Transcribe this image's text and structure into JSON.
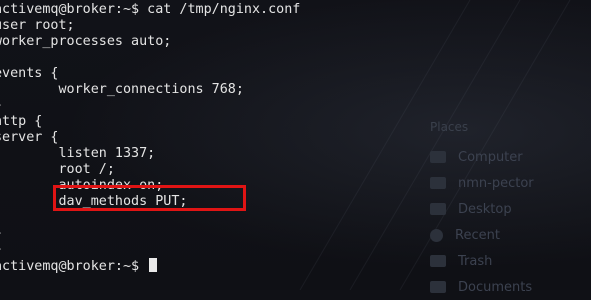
{
  "terminal": {
    "lines": [
      "activemq@broker:~$ cat /tmp/nginx.conf",
      "user root;",
      "worker_processes auto;",
      "",
      "events {",
      "        worker_connections 768;",
      "}",
      "http {",
      "server {",
      "        listen 1337;",
      "        root /;",
      "        autoindex on;",
      "        dav_methods PUT;",
      "",
      "}",
      "}",
      "activemq@broker:~$ "
    ],
    "highlighted_line_index": 12
  },
  "background": {
    "places_header": "Places",
    "places_items": [
      "Computer",
      "nmn-pector",
      "Desktop",
      "Recent",
      "Trash",
      "Documents"
    ]
  },
  "colors": {
    "terminal_bg": "#101116",
    "text": "#e4e4e4",
    "highlight_border": "#e01414"
  }
}
